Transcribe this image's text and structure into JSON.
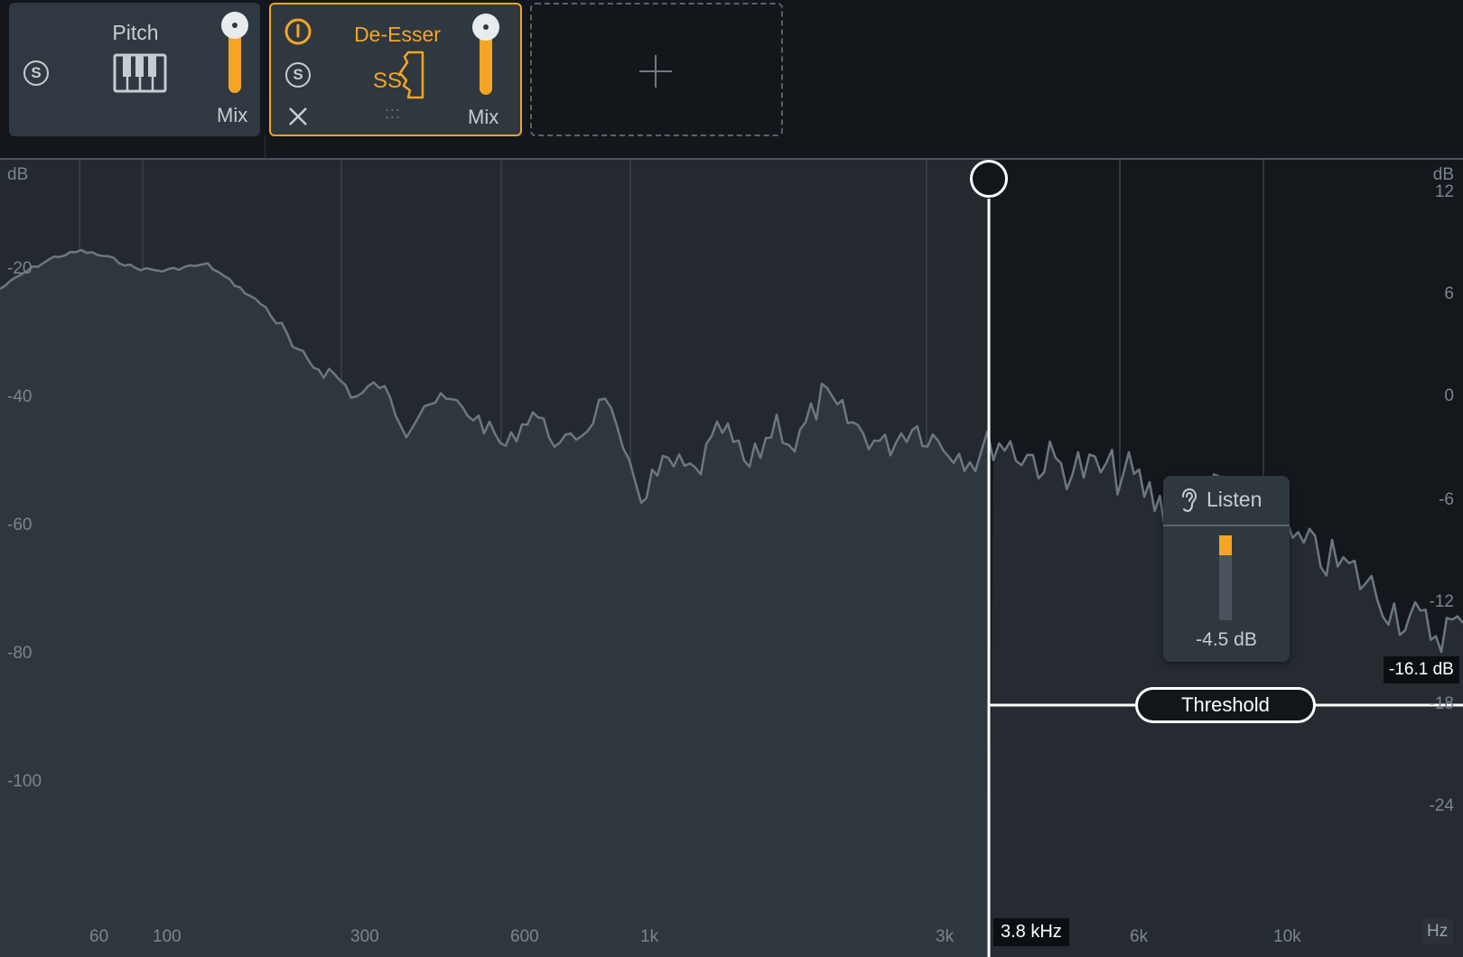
{
  "modules": {
    "pitch": {
      "title": "Pitch",
      "solo_label": "S",
      "mix_label": "Mix",
      "mix_level": 1.0
    },
    "deesser": {
      "title": "De-Esser",
      "solo_label": "S",
      "mix_label": "Mix",
      "mix_level": 1.0,
      "drag_handle": ":::"
    }
  },
  "spectrum": {
    "left_axis": {
      "unit": "dB",
      "ticks": [
        "-20",
        "-40",
        "-60",
        "-80",
        "-100"
      ]
    },
    "right_axis": {
      "unit": "dB",
      "ticks": [
        "12",
        "6",
        "0",
        "-6",
        "-12",
        "-18",
        "-24"
      ]
    },
    "freq_ticks": [
      "60",
      "100",
      "300",
      "600",
      "1k",
      "3k",
      "6k",
      "10k"
    ],
    "freq_unit": "Hz",
    "crossover_readout": "3.8 kHz",
    "threshold_readout": "-16.1 dB",
    "threshold_label": "Threshold",
    "listen": {
      "label": "Listen",
      "gain_reduction": "-4.5 dB",
      "meter_level": 0.23
    }
  },
  "colors": {
    "accent": "#f5a524",
    "background": "#23292f",
    "module_bg": "#303941",
    "strip_bg": "#13171c"
  }
}
